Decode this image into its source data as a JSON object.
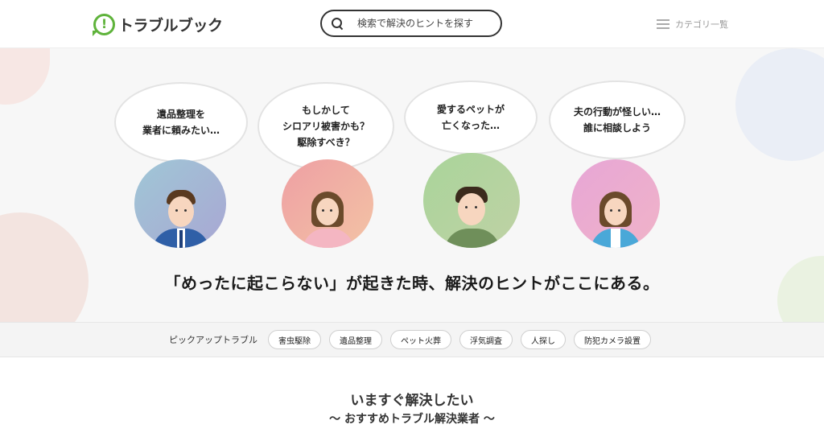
{
  "header": {
    "logo_mark": "!",
    "logo_text": "トラブルブック",
    "search_placeholder": "検索で解決のヒントを探す",
    "category_label": "カテゴリ一覧"
  },
  "hero": {
    "bubbles": [
      {
        "text": "遺品整理を\n業者に頼みたい…"
      },
      {
        "text": "もしかして\nシロアリ被害かも？\n駆除すべき？"
      },
      {
        "text": "愛するペットが\n亡くなった…"
      },
      {
        "text": "夫の行動が怪しい…\n誰に相談しよう"
      }
    ],
    "tagline": "「めったに起こらない」が起きた時、解決のヒントがここにある。"
  },
  "pickup": {
    "label": "ピックアップトラブル",
    "chips": [
      "害虫駆除",
      "遺品整理",
      "ペット火葬",
      "浮気調査",
      "人探し",
      "防犯カメラ設置"
    ]
  },
  "section": {
    "title": "いますぐ解決したい",
    "subtitle": "〜 おすすめトラブル解決業者 〜"
  },
  "colors": {
    "brand_green": "#5fb33b",
    "hero_bg": "#f7f7f7"
  }
}
